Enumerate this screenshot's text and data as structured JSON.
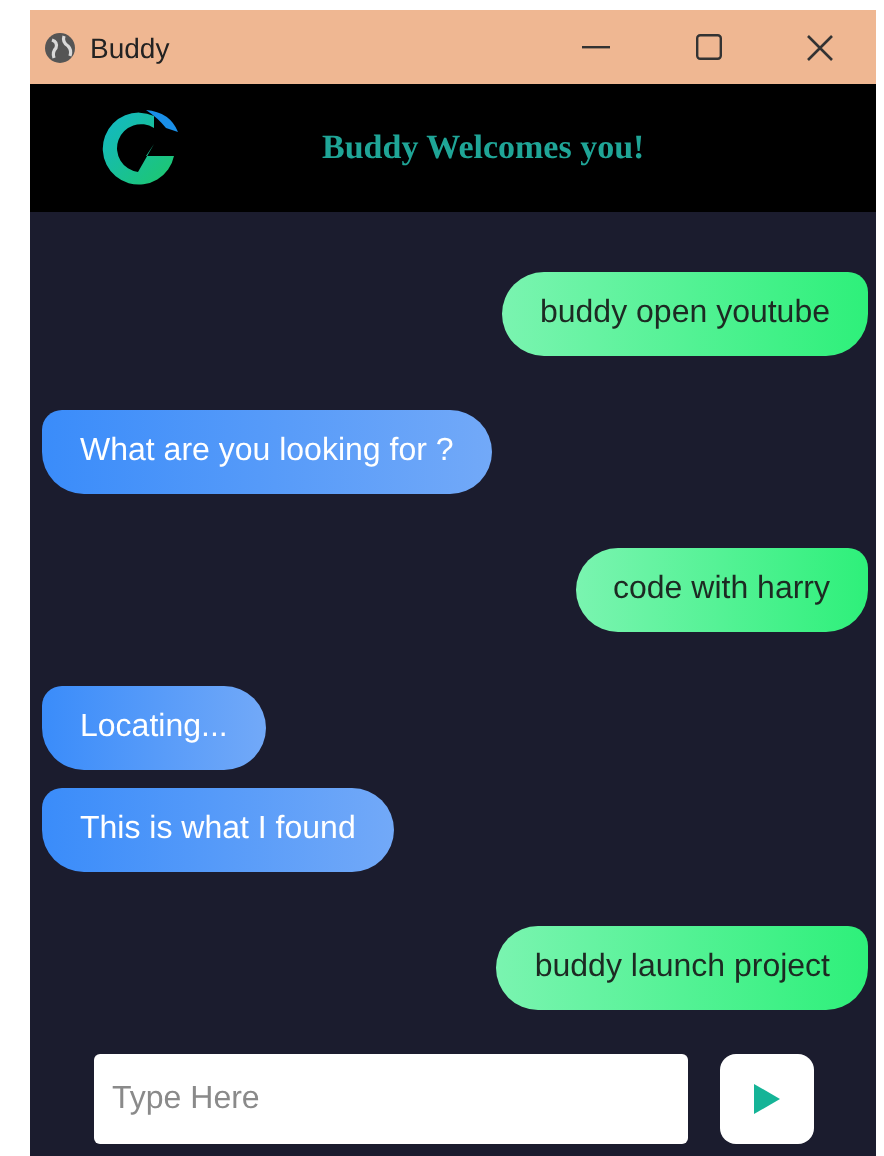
{
  "window": {
    "title": "Buddy"
  },
  "header": {
    "title": "Buddy Welcomes you!"
  },
  "messages": [
    {
      "kind": "user",
      "text": "buddy open youtube"
    },
    {
      "kind": "bot",
      "text": "What are you looking for ?"
    },
    {
      "kind": "user",
      "text": "code with harry"
    },
    {
      "kind": "bot",
      "text": "Locating..."
    },
    {
      "kind": "bot",
      "text": "This is what I found"
    },
    {
      "kind": "user",
      "text": "buddy launch project"
    }
  ],
  "input": {
    "placeholder": "Type Here"
  }
}
